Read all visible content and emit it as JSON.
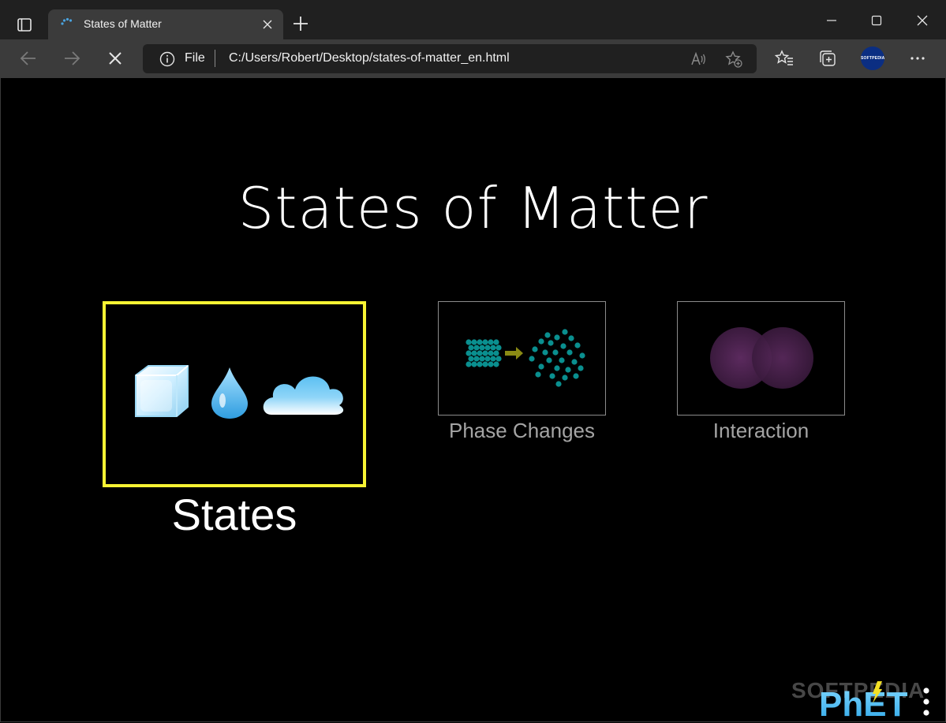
{
  "browser": {
    "tab_title": "States of Matter",
    "address_label": "File",
    "url": "C:/Users/Robert/Desktop/states-of-matter_en.html",
    "profile_text": "SOFTPEDIA"
  },
  "sim": {
    "title": "States of Matter",
    "screens": [
      {
        "label": "States",
        "selected": true
      },
      {
        "label": "Phase Changes",
        "selected": false
      },
      {
        "label": "Interaction",
        "selected": false
      }
    ],
    "logo_text": "PhET",
    "watermark": "SOFTPEDIA"
  },
  "colors": {
    "selected_border": "#f7f333",
    "unselected_border": "#8b8b8b",
    "molecule": "#0a8f8f",
    "atom": "#4a1f4d"
  },
  "icons": [
    "tab-actions-icon",
    "loading-spinner-icon",
    "close-icon",
    "plus-icon",
    "minimize-icon",
    "maximize-icon",
    "close-window-icon",
    "back-icon",
    "forward-icon",
    "stop-icon",
    "info-icon",
    "read-aloud-icon",
    "add-favorite-icon",
    "favorites-icon",
    "collections-icon",
    "more-icon",
    "phet-menu-icon"
  ]
}
